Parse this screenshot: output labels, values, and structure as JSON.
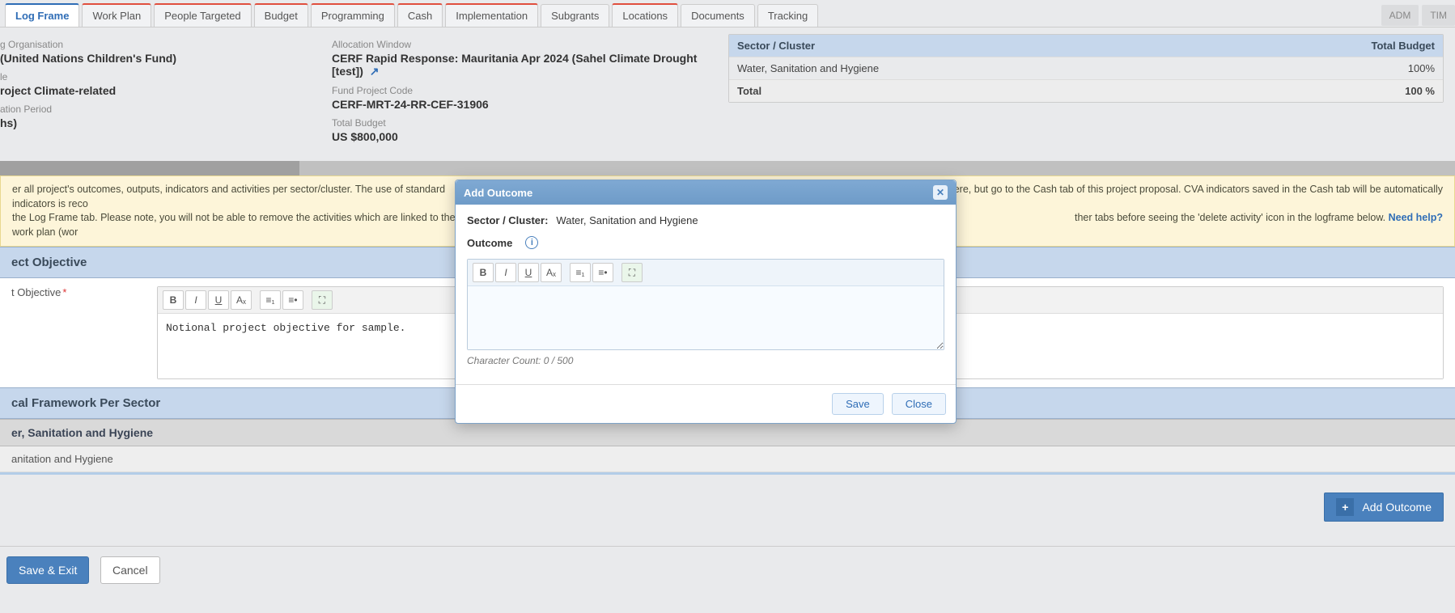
{
  "tabs": {
    "items": [
      {
        "label": "Log Frame",
        "active": true,
        "accent": false
      },
      {
        "label": "Work Plan",
        "active": false,
        "accent": true
      },
      {
        "label": "People Targeted",
        "active": false,
        "accent": true
      },
      {
        "label": "Budget",
        "active": false,
        "accent": true
      },
      {
        "label": "Programming",
        "active": false,
        "accent": true
      },
      {
        "label": "Cash",
        "active": false,
        "accent": true
      },
      {
        "label": "Implementation",
        "active": false,
        "accent": true
      },
      {
        "label": "Subgrants",
        "active": false,
        "accent": false
      },
      {
        "label": "Locations",
        "active": false,
        "accent": true
      },
      {
        "label": "Documents",
        "active": false,
        "accent": false
      },
      {
        "label": "Tracking",
        "active": false,
        "accent": false
      }
    ],
    "right": [
      "ADM",
      "TIM"
    ]
  },
  "info": {
    "col1": {
      "l1": "g Organisation",
      "v1": "(United Nations Children's Fund)",
      "l2": "le",
      "v2": "roject Climate-related",
      "l3": "ation Period",
      "v3": "hs)"
    },
    "col2": {
      "l1": "Allocation Window",
      "v1": "CERF Rapid Response: Mauritania Apr 2024 (Sahel Climate Drought [test])",
      "l2": "Fund Project Code",
      "v2": "CERF-MRT-24-RR-CEF-31906",
      "l3": "Total Budget",
      "v3": "US $800,000"
    }
  },
  "sectorBudget": {
    "head_left": "Sector / Cluster",
    "head_right": "Total Budget",
    "rows": [
      {
        "name": "Water, Sanitation and Hygiene",
        "pct": "100%"
      }
    ],
    "total_label": "Total",
    "total_pct": "100 %"
  },
  "helpBanner": {
    "textA": "er all project's outcomes, outputs, indicators and activities per sector/cluster. The use of standard indicators is reco",
    "textB": "ators here, but go to the Cash tab of this project proposal. CVA indicators saved in the Cash tab will be automatically",
    "textC": " the Log Frame tab. Please note, you will not be able to remove the activities which are linked to the work plan (wor",
    "textD": "ther tabs before seeing the 'delete activity' icon in the logframe below. ",
    "link": "Need help?"
  },
  "sections": {
    "objective_header": "ect Objective",
    "objective_label": "t Objective",
    "objective_value": "Notional project objective for sample.",
    "framework_header": "cal Framework Per Sector",
    "sector_bar": "er, Sanitation and Hygiene",
    "sector_row": "anitation and Hygiene",
    "add_outcome": "Add Outcome"
  },
  "footer": {
    "save_exit": "Save & Exit",
    "cancel": "Cancel"
  },
  "modal": {
    "title": "Add Outcome",
    "sector_label": "Sector / Cluster:",
    "sector_value": "Water, Sanitation and Hygiene",
    "outcome_label": "Outcome",
    "char_count": "Character Count: 0 / 500",
    "save": "Save",
    "close": "Close"
  }
}
